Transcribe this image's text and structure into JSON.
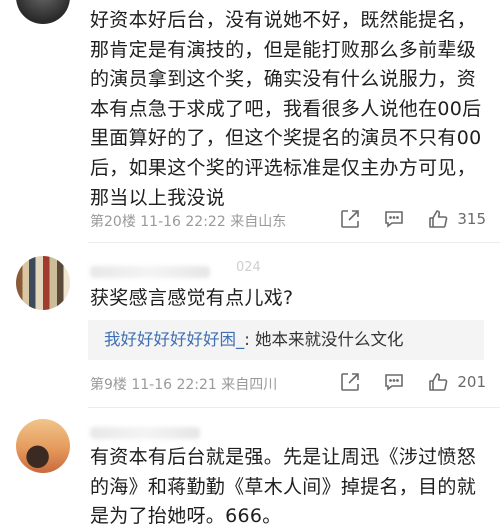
{
  "comments": [
    {
      "text": "好资本好后台，没有说她不好，既然能提名，那肯定是有演技的，但是能打败那么多前辈级的演员拿到这个奖，确实没有什么说服力，资本有点急于求成了吧，我看很多人说他在00后里面算好的了，但这个奖提名的演员不只有00后，如果这个奖的评选标准是仅主办方可见，那当以上我没说",
      "meta": "第20楼 11-16 22:22 来自山东",
      "likes": "315"
    },
    {
      "username_fragment": "024",
      "text": "获奖感言感觉有点儿戏?",
      "quote_user": "我好好好好好好困_",
      "quote_text": ": 她本来就没什么文化",
      "meta": "第9楼 11-16 22:21 来自四川",
      "likes": "201"
    },
    {
      "text": "有资本有后台就是强。先是让周迅《涉过愤怒的海》和蒋勤勤《草木人间》掉提名，目的就是为了抬她呀。666。"
    }
  ],
  "icons": {
    "share": "share-icon",
    "comment": "comment-icon",
    "like": "thumbs-up-icon"
  },
  "colors": {
    "link_blue": "#3f6fb3",
    "meta_gray": "#9a9a9a"
  }
}
